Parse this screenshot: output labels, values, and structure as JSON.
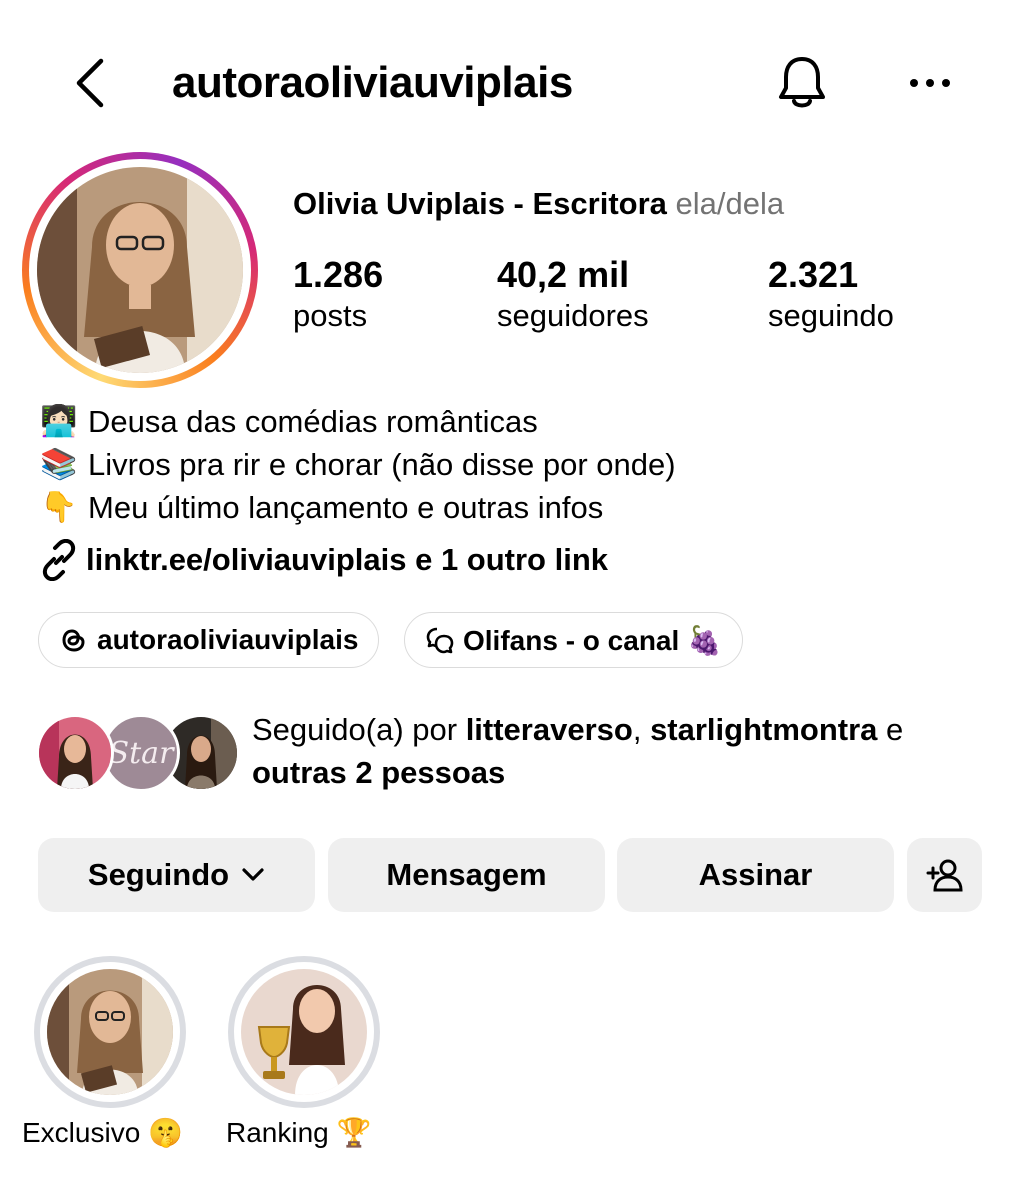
{
  "header": {
    "username": "autoraoliviauviplais",
    "icons": {
      "back": "chevron-left-icon",
      "notifications": "bell-icon",
      "more": "more-horizontal-icon"
    }
  },
  "profile": {
    "full_name": "Olivia Uviplais - Escritora",
    "pronouns": "ela/dela",
    "story_ring_colors": [
      "#feda75",
      "#fa7e1e",
      "#d62976",
      "#962fbf"
    ],
    "stats": [
      {
        "value": "1.286",
        "label": "posts"
      },
      {
        "value": "40,2 mil",
        "label": "seguidores"
      },
      {
        "value": "2.321",
        "label": "seguindo"
      }
    ]
  },
  "bio": {
    "lines": [
      {
        "emoji": "👩🏻‍💻",
        "text": "Deusa das comédias românticas"
      },
      {
        "emoji": "📚",
        "text": "Livros pra rir e chorar (não disse por onde)"
      },
      {
        "emoji": "👇",
        "text": "Meu último lançamento e outras infos"
      }
    ],
    "link_text": "linktr.ee/oliviauviplais e 1 outro link"
  },
  "chips": [
    {
      "icon": "threads-icon",
      "label": "autoraoliviauviplais"
    },
    {
      "icon": "broadcast-channel-icon",
      "label": "Olifans - o canal 🍇"
    }
  ],
  "followed_by": {
    "prefix": "Seguido(a) por ",
    "user1": "litteraverso",
    "sep": ", ",
    "user2": "starlightmontra",
    "conj": " e",
    "others": "outras 2 pessoas",
    "avatar_text": "Star"
  },
  "actions": {
    "following": "Seguindo",
    "message": "Mensagem",
    "subscribe": "Assinar"
  },
  "highlights": [
    {
      "label": "Exclusivo 🤫"
    },
    {
      "label": "Ranking 🏆"
    }
  ]
}
